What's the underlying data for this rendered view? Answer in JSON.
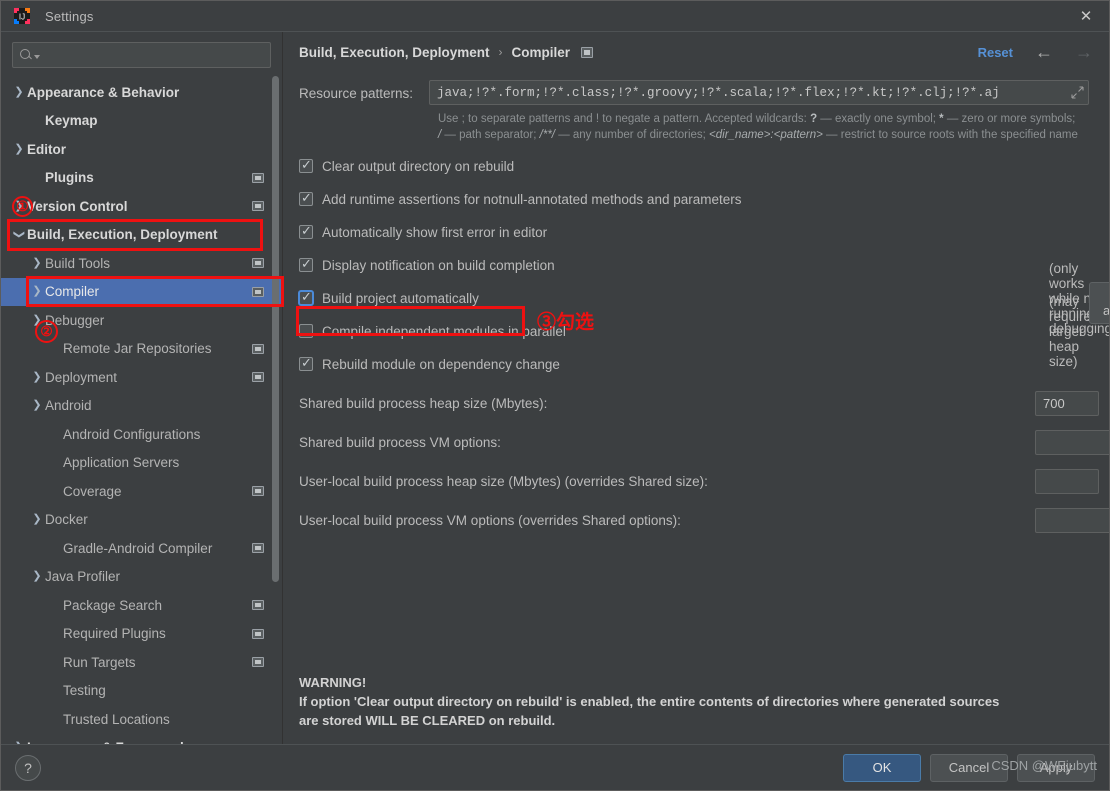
{
  "window": {
    "title": "Settings",
    "logo_icon": "intellij-idea-logo",
    "close_icon": "close-icon"
  },
  "sidebar": {
    "search": {
      "placeholder": "",
      "value": "",
      "icon": "search-icon",
      "caret_icon": "chevron-down-icon"
    },
    "items": [
      {
        "label": "Appearance & Behavior",
        "arrow": "right",
        "top": true,
        "badge": false,
        "indent": 0,
        "selected": false
      },
      {
        "label": "Keymap",
        "arrow": "none",
        "top": true,
        "badge": false,
        "indent": 1,
        "selected": false
      },
      {
        "label": "Editor",
        "arrow": "right",
        "top": true,
        "badge": false,
        "indent": 0,
        "selected": false
      },
      {
        "label": "Plugins",
        "arrow": "none",
        "top": true,
        "badge": true,
        "indent": 1,
        "selected": false
      },
      {
        "label": "Version Control",
        "arrow": "right",
        "top": true,
        "badge": true,
        "indent": 0,
        "selected": false
      },
      {
        "label": "Build, Execution, Deployment",
        "arrow": "down",
        "top": true,
        "badge": false,
        "indent": 0,
        "selected": false
      },
      {
        "label": "Build Tools",
        "arrow": "right",
        "top": false,
        "badge": true,
        "indent": 1,
        "selected": false
      },
      {
        "label": "Compiler",
        "arrow": "right",
        "top": false,
        "badge": true,
        "indent": 1,
        "selected": true
      },
      {
        "label": "Debugger",
        "arrow": "right",
        "top": false,
        "badge": false,
        "indent": 1,
        "selected": false
      },
      {
        "label": "Remote Jar Repositories",
        "arrow": "none",
        "top": false,
        "badge": true,
        "indent": 2,
        "selected": false
      },
      {
        "label": "Deployment",
        "arrow": "right",
        "top": false,
        "badge": true,
        "indent": 1,
        "selected": false
      },
      {
        "label": "Android",
        "arrow": "right",
        "top": false,
        "badge": false,
        "indent": 1,
        "selected": false
      },
      {
        "label": "Android Configurations",
        "arrow": "none",
        "top": false,
        "badge": false,
        "indent": 2,
        "selected": false
      },
      {
        "label": "Application Servers",
        "arrow": "none",
        "top": false,
        "badge": false,
        "indent": 2,
        "selected": false
      },
      {
        "label": "Coverage",
        "arrow": "none",
        "top": false,
        "badge": true,
        "indent": 2,
        "selected": false
      },
      {
        "label": "Docker",
        "arrow": "right",
        "top": false,
        "badge": false,
        "indent": 1,
        "selected": false
      },
      {
        "label": "Gradle-Android Compiler",
        "arrow": "none",
        "top": false,
        "badge": true,
        "indent": 2,
        "selected": false
      },
      {
        "label": "Java Profiler",
        "arrow": "right",
        "top": false,
        "badge": false,
        "indent": 1,
        "selected": false
      },
      {
        "label": "Package Search",
        "arrow": "none",
        "top": false,
        "badge": true,
        "indent": 2,
        "selected": false
      },
      {
        "label": "Required Plugins",
        "arrow": "none",
        "top": false,
        "badge": true,
        "indent": 2,
        "selected": false
      },
      {
        "label": "Run Targets",
        "arrow": "none",
        "top": false,
        "badge": true,
        "indent": 2,
        "selected": false
      },
      {
        "label": "Testing",
        "arrow": "none",
        "top": false,
        "badge": false,
        "indent": 2,
        "selected": false
      },
      {
        "label": "Trusted Locations",
        "arrow": "none",
        "top": false,
        "badge": false,
        "indent": 2,
        "selected": false
      },
      {
        "label": "Languages & Frameworks",
        "arrow": "right",
        "top": true,
        "badge": false,
        "indent": 0,
        "selected": false
      }
    ]
  },
  "header": {
    "crumb_parent": "Build, Execution, Deployment",
    "crumb_sep": "›",
    "crumb_current": "Compiler",
    "badge_icon": "project-settings-badge-icon",
    "reset_label": "Reset",
    "back_icon": "arrow-left-icon",
    "forward_icon": "arrow-right-icon"
  },
  "main": {
    "resource_patterns_label": "Resource patterns:",
    "resource_patterns_value": "java;!?*.form;!?*.class;!?*.groovy;!?*.scala;!?*.flex;!?*.kt;!?*.clj;!?*.aj",
    "expand_icon": "expand-field-icon",
    "hint_line1_a": "Use ; to separate patterns and ! to negate a pattern. Accepted wildcards: ",
    "hint_q": "?",
    "hint_line1_b": " — exactly one symbol; ",
    "hint_star": "*",
    "hint_line1_c": " — zero or",
    "hint_line2_a": "more symbols; ",
    "hint_slash": "/",
    "hint_line2_b": " — path separator; ",
    "hint_globstar": "/**/",
    "hint_line2_c": " — any number of directories; ",
    "hint_dirpattern": "<dir_name>:<pattern>",
    "hint_line2_d": " — restrict to source",
    "hint_line3": "roots with the specified name",
    "checkboxes": [
      {
        "label": "Clear output directory on rebuild",
        "checked": true,
        "focused": false,
        "note": ""
      },
      {
        "label": "Add runtime assertions for notnull-annotated methods and parameters",
        "checked": true,
        "focused": false,
        "note": ""
      },
      {
        "label": "Automatically show first error in editor",
        "checked": true,
        "focused": false,
        "note": ""
      },
      {
        "label": "Display notification on build completion",
        "checked": true,
        "focused": false,
        "note": ""
      },
      {
        "label": "Build project automatically",
        "checked": true,
        "focused": true,
        "note": "(only works while not running / debugging)"
      },
      {
        "label": "Compile independent modules in parallel",
        "checked": false,
        "focused": false,
        "note": "(may require larger heap size)"
      },
      {
        "label": "Rebuild module on dependency change",
        "checked": true,
        "focused": false,
        "note": ""
      }
    ],
    "configure_annotations_label": "Configure annotations...",
    "fields": [
      {
        "label": "Shared build process heap size (Mbytes):",
        "value": "700",
        "size": "narrow",
        "expandable": false
      },
      {
        "label": "Shared build process VM options:",
        "value": "",
        "size": "wide",
        "expandable": true
      },
      {
        "label": "User-local build process heap size (Mbytes) (overrides Shared size):",
        "value": "",
        "size": "narrow",
        "expandable": false
      },
      {
        "label": "User-local build process VM options (overrides Shared options):",
        "value": "",
        "size": "wide",
        "expandable": true
      }
    ],
    "warning_title": "WARNING!",
    "warning_line1": "If option 'Clear output directory on rebuild' is enabled, the entire contents of directories where generated sources",
    "warning_line2": "are stored WILL BE CLEARED on rebuild."
  },
  "footer": {
    "help_label": "?",
    "ok_label": "OK",
    "cancel_label": "Cancel",
    "apply_label": "Apply",
    "watermark": "CSDN @WEjubytt"
  },
  "annotations": {
    "marker1": "①",
    "marker2": "②",
    "marker3": "③勾选",
    "color": "#ee1111"
  }
}
